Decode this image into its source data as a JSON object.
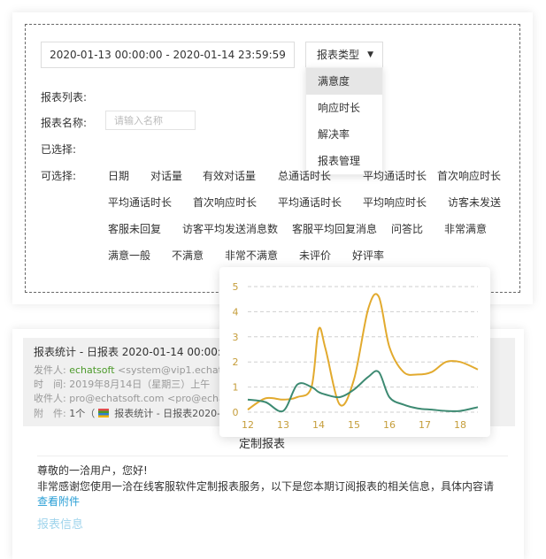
{
  "filters": {
    "date_range": "2020-01-13  00:00:00 - 2020-01-14  23:59:59",
    "report_type_label": "报表类型",
    "report_type_options": [
      "满意度",
      "响应时长",
      "解决率",
      "报表管理"
    ],
    "report_list_label": "报表列表:",
    "report_name_label": "报表名称:",
    "report_name_placeholder": "请输入名称",
    "selected_label": "已选择:",
    "selectable_label": "可选择:",
    "selectable_items": [
      "日期",
      "对话量",
      "有效对话量",
      "总通话时长",
      "平均通话时长",
      "首次响应时长",
      "平均通话时长",
      "首次响应时长",
      "平均通话时长",
      "平均响应时长",
      "访客未发送",
      "客服未回复",
      "访客平均发送消息数",
      "客服平均回复消息",
      "问答比",
      "非常满意",
      "满意一般",
      "不满意",
      "非常不满意",
      "未评价",
      "好评率"
    ]
  },
  "mail": {
    "subject": "报表统计 - 日报表 2020-01-14  00:00:00",
    "sender_label": "发件人:",
    "sender_name": "echatsoft",
    "sender_email": "<system@vip1.echatsoft.com>",
    "time_label": "时　间:",
    "time_value": "2019年8月14日（星期三）上午",
    "to_label": "收件人:",
    "to_value": "pro@echatsoft.com <pro@echatsoft.com>",
    "attach_label": "附　件:",
    "attach_value": "1个（",
    "attach_name": "报表统计 - 日报表2020-01-14",
    "report_title": "定制报表",
    "greeting": "尊敬的一洽用户，您好!",
    "body": "非常感谢您使用一洽在线客服软件定制报表服务，以下是您本期订阅报表的相关信息，具体内容请",
    "view_attachment": "查看附件",
    "report_info": "报表信息"
  },
  "chart_data": {
    "type": "line",
    "x": [
      12,
      12.5,
      13,
      13.4,
      13.8,
      14,
      14.2,
      14.6,
      15,
      15.4,
      15.7,
      16,
      16.4,
      16.8,
      17.2,
      17.6,
      18,
      18.5
    ],
    "xticks": [
      "12",
      "13",
      "14",
      "15",
      "16",
      "17",
      "18"
    ],
    "ylim": [
      0,
      5
    ],
    "yticks": [
      "0",
      "1",
      "2",
      "3",
      "4",
      "5"
    ],
    "grid": "dashed horizontal",
    "series": [
      {
        "color": "#e2aa2e",
        "values": [
          0.1,
          0.55,
          0.5,
          0.6,
          1.0,
          3.3,
          2.5,
          0.3,
          1.3,
          4.1,
          4.6,
          2.6,
          1.6,
          1.5,
          1.6,
          2.0,
          2.0,
          1.7
        ]
      },
      {
        "color": "#3d8a72",
        "values": [
          0.5,
          0.4,
          0.05,
          1.1,
          1.0,
          0.8,
          0.7,
          0.6,
          0.9,
          1.4,
          1.6,
          0.6,
          0.3,
          0.15,
          0.1,
          0.05,
          0.05,
          0.2
        ]
      }
    ]
  }
}
